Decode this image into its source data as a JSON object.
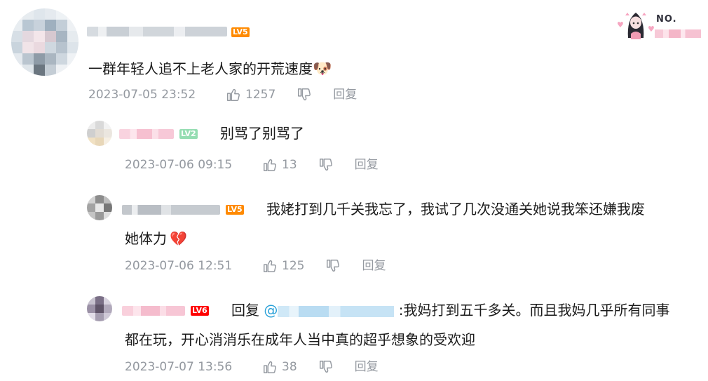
{
  "comment": {
    "text": "一群年轻人追不上老人家的开荒速度",
    "emoji": "🐶",
    "level": "LV5",
    "timestamp": "2023-07-05 23:52",
    "likes": "1257",
    "reply_label": "回复"
  },
  "decoration": {
    "medal_text": "NO."
  },
  "replies": [
    {
      "level": "LV2",
      "text": "别骂了别骂了",
      "timestamp": "2023-07-06 09:15",
      "likes": "13",
      "reply_label": "回复"
    },
    {
      "level": "LV5",
      "text_line1": "我姥打到几千关我忘了，我试了几次没通关她说我笨还嫌我废",
      "text_line2": "她体力",
      "emoji": "💔",
      "timestamp": "2023-07-06 12:51",
      "likes": "125",
      "reply_label": "回复"
    },
    {
      "level": "LV6",
      "reply_prefix": "回复",
      "mention_at": "@",
      "text_line1": ":我妈打到五千多关。而且我妈几乎所有同事",
      "text_line2": "都在玩，开心消消乐在成年人当中真的超乎想象的受欢迎",
      "timestamp": "2023-07-07 13:56",
      "likes": "38",
      "reply_label": "回复"
    }
  ],
  "colors": {
    "lv2": "#95ddb2",
    "lv5": "#fb7299",
    "lv5_alt": "#ff8a00",
    "lv6": "#ff0000",
    "meta_gray": "#9499a0",
    "mention_blur": "#cfe8f7"
  },
  "icons": {
    "like": "thumb-up-icon",
    "dislike": "thumb-down-icon"
  }
}
